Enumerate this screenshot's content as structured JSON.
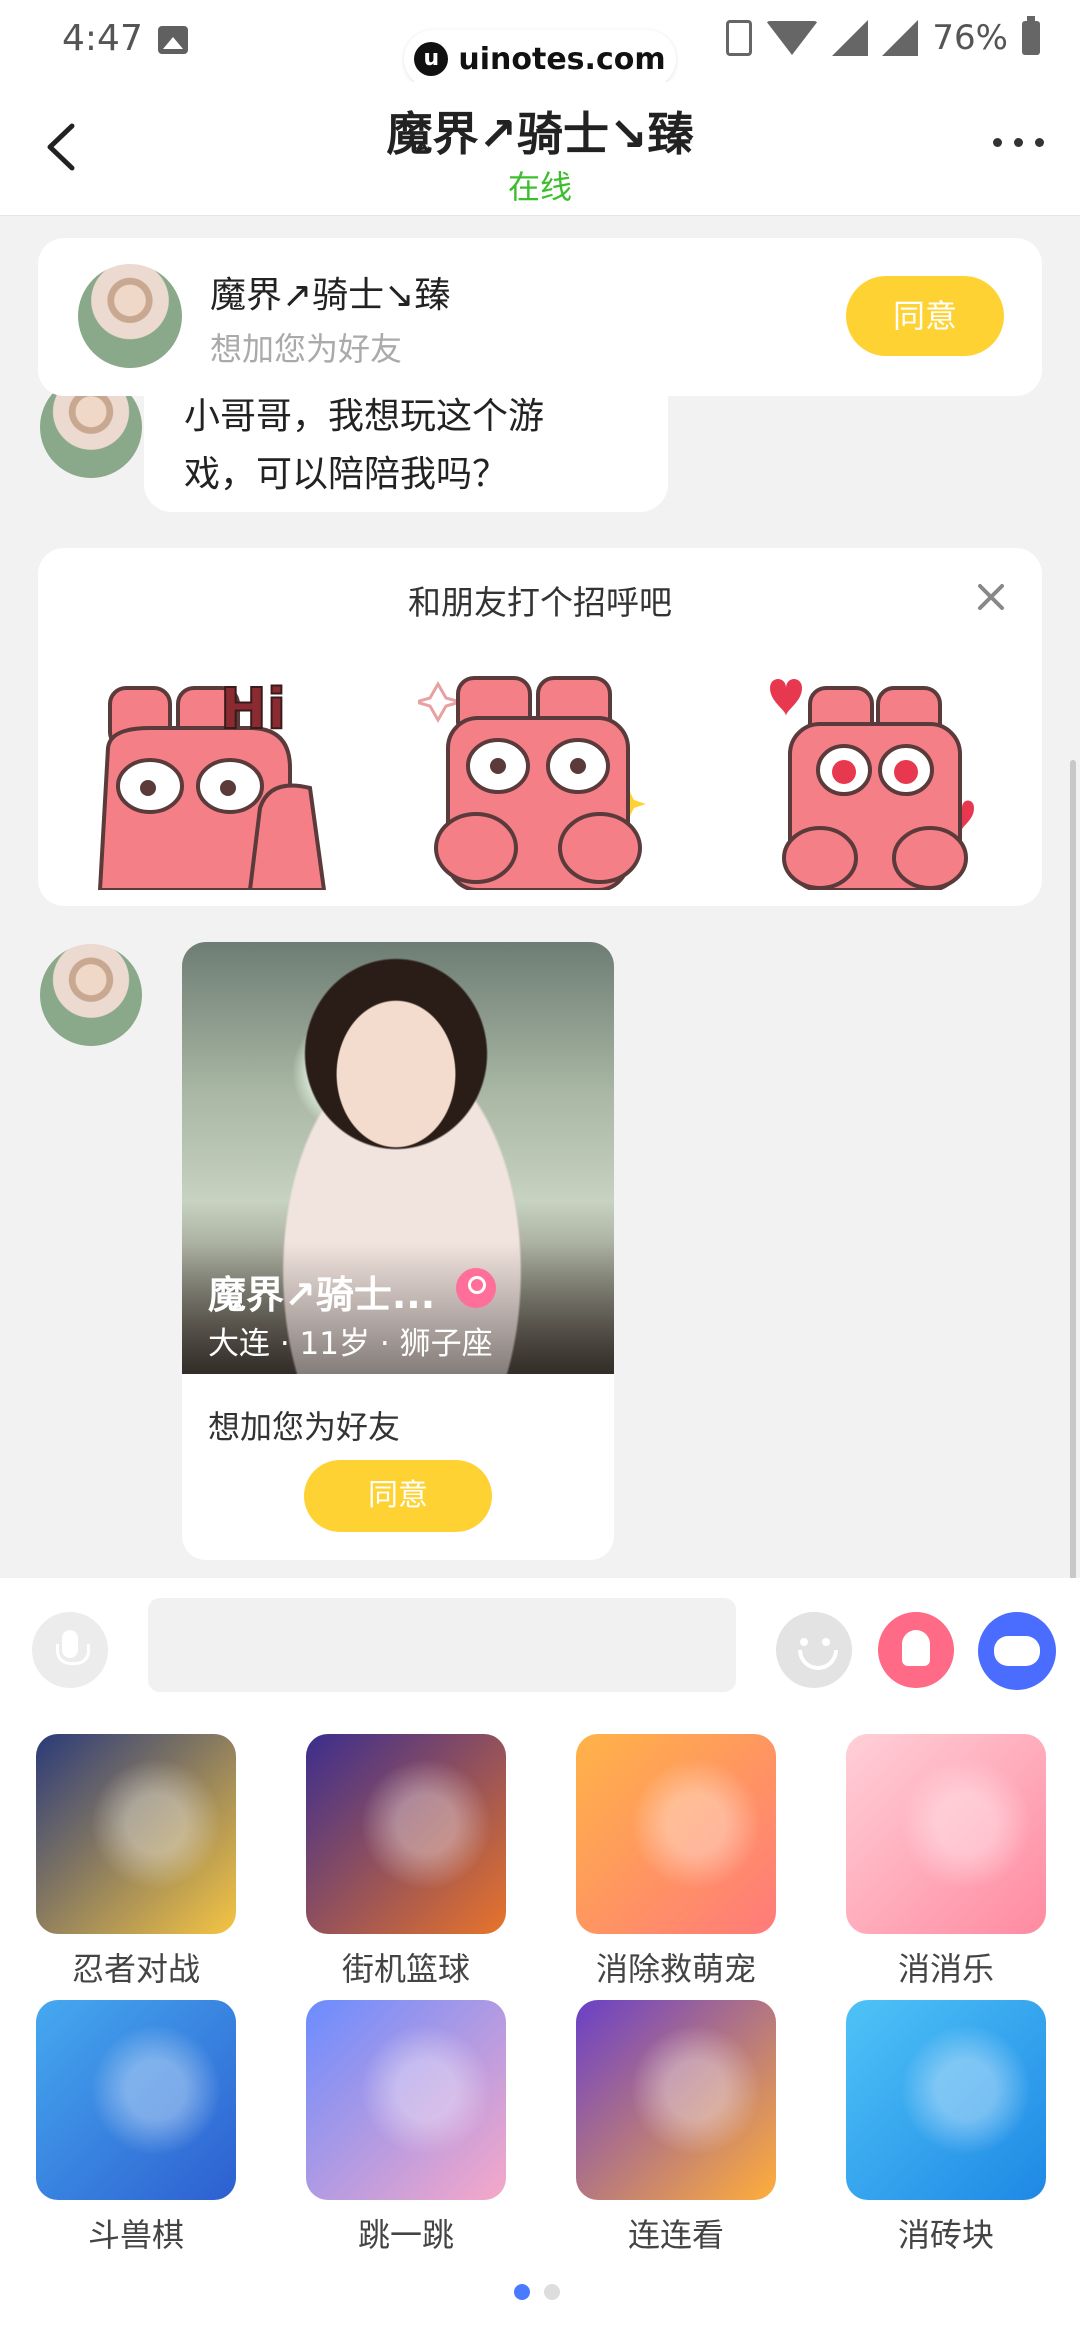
{
  "status_bar": {
    "time": "4:47",
    "battery": "76%",
    "watermark": "uinotes.com"
  },
  "header": {
    "title": "魔界↗骑士↘臻",
    "status": "在线"
  },
  "friend_request": {
    "name": "魔界↗骑士↘臻",
    "subtitle": "想加您为好友",
    "accept_label": "同意"
  },
  "message": {
    "text_line1": "小哥哥，我想玩这个游",
    "text_line2": "戏，可以陪陪我吗？"
  },
  "greeting": {
    "title": "和朋友打个招呼吧",
    "stickers": [
      "hi-sticker",
      "thumbs-sticker",
      "heart-sticker"
    ]
  },
  "profile_card": {
    "name": "魔界↗骑士...",
    "meta": "大连 · 11岁 · 狮子座",
    "subtitle": "想加您为好友",
    "accept_label": "同意"
  },
  "games": [
    {
      "label": "忍者对战",
      "colors": [
        "#2a3a7a",
        "#f5c542"
      ]
    },
    {
      "label": "街机篮球",
      "colors": [
        "#3b2d8f",
        "#e8742a"
      ]
    },
    {
      "label": "消除救萌宠",
      "colors": [
        "#ffb347",
        "#ff7a7a"
      ]
    },
    {
      "label": "消消乐",
      "colors": [
        "#ffd0d8",
        "#ff8aa0"
      ]
    },
    {
      "label": "斗兽棋",
      "colors": [
        "#45a9f0",
        "#2d5fd0"
      ]
    },
    {
      "label": "跳一跳",
      "colors": [
        "#6a8cff",
        "#f7a8c8"
      ]
    },
    {
      "label": "连连看",
      "colors": [
        "#6a3fc8",
        "#ffae3a"
      ]
    },
    {
      "label": "消砖块",
      "colors": [
        "#4fc3f7",
        "#1e88e5"
      ]
    }
  ],
  "pager": {
    "pages": 2,
    "current": 1
  }
}
